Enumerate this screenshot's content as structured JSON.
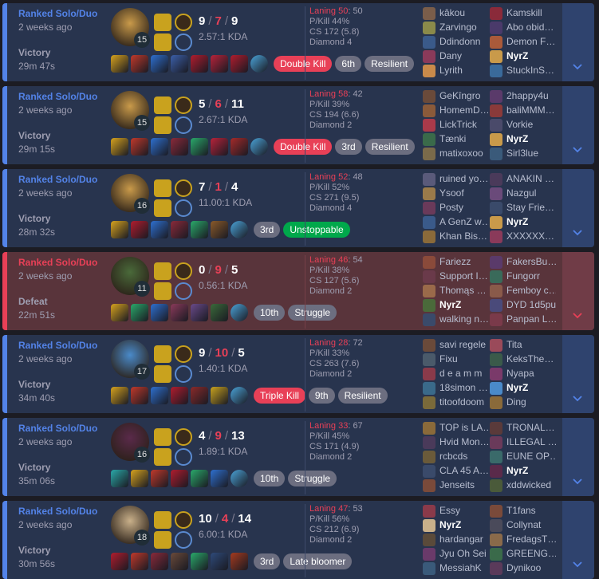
{
  "colors": {
    "win_accent": "#5383e8",
    "loss_accent": "#e84057",
    "win_bg": "#28344e",
    "loss_bg": "#59343b",
    "multikill": "#e84057",
    "unstoppable": "#00a84b"
  },
  "matches": [
    {
      "result_type": "win",
      "queue": "Ranked Solo/Duo",
      "ago": "2 weeks ago",
      "result": "Victory",
      "duration": "29m 47s",
      "level": "15",
      "kills": "9",
      "deaths": "7",
      "assists": "9",
      "kda": "2.57:1 KDA",
      "laning_label": "Laning 50",
      "laning_opp": ": 50",
      "pkill": "P/Kill 44%",
      "cs": "CS 172 (5.8)",
      "rank": "Diamond 4",
      "badges": [
        {
          "text": "Double Kill",
          "kind": "mk"
        },
        {
          "text": "6th",
          "kind": ""
        },
        {
          "text": "Resilient",
          "kind": ""
        }
      ],
      "champ_color": "#c99a4a",
      "items": [
        "#d6a21e",
        "#c0392b",
        "#2e6fcf",
        "#3b5fa8",
        "#b01c2e",
        "#b7233a",
        "#b01c2e",
        "#4aa3d8"
      ],
      "team1": [
        "kâkou",
        "Zarvingo",
        "Ddindonn",
        "Dany",
        "Lyrith"
      ],
      "team2": [
        "Kamskill",
        "Abo obid…",
        "Demon F…",
        "NyrZ",
        "StuckInS…"
      ],
      "me_team": 2,
      "me_index": 3,
      "t1c": [
        "#7a5d4a",
        "#8a8a4a",
        "#3a5a8a",
        "#8a3a5a",
        "#c98a4a"
      ],
      "t2c": [
        "#8a2a3a",
        "#4a3a6a",
        "#aa5a3a",
        "#c99a4a",
        "#3a6a9a"
      ]
    },
    {
      "result_type": "win",
      "queue": "Ranked Solo/Duo",
      "ago": "2 weeks ago",
      "result": "Victory",
      "duration": "29m 15s",
      "level": "15",
      "kills": "5",
      "deaths": "6",
      "assists": "11",
      "kda": "2.67:1 KDA",
      "laning_label": "Laning 58",
      "laning_opp": ": 42",
      "pkill": "P/Kill 39%",
      "cs": "CS 194 (6.6)",
      "rank": "Diamond 2",
      "badges": [
        {
          "text": "Double Kill",
          "kind": "mk"
        },
        {
          "text": "3rd",
          "kind": ""
        },
        {
          "text": "Resilient",
          "kind": ""
        }
      ],
      "champ_color": "#c99a4a",
      "items": [
        "#d6a21e",
        "#c0392b",
        "#2e6fcf",
        "#8a2a3a",
        "#2aa86a",
        "#b7233a",
        "#a52a2a",
        "#4aa3d8"
      ],
      "team1": [
        "GeKîngro",
        "HomemD…",
        "LickTrick",
        "Tænki",
        "matixoxoo"
      ],
      "team2": [
        "2happy4u",
        "baliMMM…",
        "Vorkie",
        "NyrZ",
        "Sirl3lue"
      ],
      "me_team": 2,
      "me_index": 3,
      "t1c": [
        "#6a4a3a",
        "#8a5a3a",
        "#aa3a4a",
        "#3a6a4a",
        "#7a6a4a"
      ],
      "t2c": [
        "#5a3a6a",
        "#8a3a3a",
        "#4a4a6a",
        "#c99a4a",
        "#3a5a7a"
      ]
    },
    {
      "result_type": "win",
      "queue": "Ranked Solo/Duo",
      "ago": "2 weeks ago",
      "result": "Victory",
      "duration": "28m 32s",
      "level": "16",
      "kills": "7",
      "deaths": "1",
      "assists": "4",
      "kda": "11.00:1 KDA",
      "laning_label": "Laning 52",
      "laning_opp": ": 48",
      "pkill": "P/Kill 52%",
      "cs": "CS 271 (9.5)",
      "rank": "Diamond 4",
      "badges": [
        {
          "text": "3rd",
          "kind": ""
        },
        {
          "text": "Unstoppable",
          "kind": "un"
        }
      ],
      "champ_color": "#c99a4a",
      "items": [
        "#d6a21e",
        "#b01c2e",
        "#2e6fcf",
        "#8a2a3a",
        "#2aa86a",
        "#8a5a2a",
        "#4aa3d8"
      ],
      "team1": [
        "ruined yo…",
        "Ysoof",
        "Posty",
        "A GenZ w…",
        "Khan Bis…"
      ],
      "team2": [
        "ANAKIN …",
        "Nazgul",
        "Stay Frie…",
        "NyrZ",
        "XXXXXX…"
      ],
      "me_team": 2,
      "me_index": 3,
      "t1c": [
        "#5a5a7a",
        "#9a7a4a",
        "#6a3a5a",
        "#3a5a8a",
        "#8a6a3a"
      ],
      "t2c": [
        "#4a3a5a",
        "#6a4a7a",
        "#3a4a6a",
        "#c99a4a",
        "#8a3a5a"
      ]
    },
    {
      "result_type": "loss",
      "queue": "Ranked Solo/Duo",
      "ago": "2 weeks ago",
      "result": "Defeat",
      "duration": "22m 51s",
      "level": "11",
      "kills": "0",
      "deaths": "9",
      "assists": "5",
      "kda": "0.56:1 KDA",
      "laning_label": "Laning 46",
      "laning_opp": ": 54",
      "pkill": "P/Kill 38%",
      "cs": "CS 127 (5.6)",
      "rank": "Diamond 2",
      "badges": [
        {
          "text": "10th",
          "kind": ""
        },
        {
          "text": "Struggle",
          "kind": ""
        }
      ],
      "champ_color": "#4a6a3a",
      "items": [
        "#d6a21e",
        "#2aa86a",
        "#2e6fcf",
        "#8a3a5a",
        "#6a4a8a",
        "#3a6a3a",
        "#4aa3d8"
      ],
      "team1": [
        "Fariezz",
        "Support I…",
        "Thomąs …",
        "NyrZ",
        "walking n…"
      ],
      "team2": [
        "FakersBu…",
        "Fungorr",
        "Femboy c…",
        "DYD 1d5pu",
        "Panpan L…"
      ],
      "me_team": 1,
      "me_index": 3,
      "t1c": [
        "#8a4a3a",
        "#6a3a4a",
        "#9a6a4a",
        "#4a6a3a",
        "#3a4a6a"
      ],
      "t2c": [
        "#5a3a6a",
        "#3a6a5a",
        "#8a5a4a",
        "#4a4a7a",
        "#7a3a4a"
      ]
    },
    {
      "result_type": "win",
      "queue": "Ranked Solo/Duo",
      "ago": "2 weeks ago",
      "result": "Victory",
      "duration": "34m 40s",
      "level": "17",
      "kills": "9",
      "deaths": "10",
      "assists": "5",
      "kda": "1.40:1 KDA",
      "laning_label": "Laning 28",
      "laning_opp": ": 72",
      "pkill": "P/Kill 33%",
      "cs": "CS 263 (7.6)",
      "rank": "Diamond 2",
      "badges": [
        {
          "text": "Triple Kill",
          "kind": "mk"
        },
        {
          "text": "9th",
          "kind": ""
        },
        {
          "text": "Resilient",
          "kind": ""
        }
      ],
      "champ_color": "#4a8ac9",
      "items": [
        "#d6a21e",
        "#c0392b",
        "#2e6fcf",
        "#b01c2e",
        "#8a2a2a",
        "#c9a21e",
        "#4aa3d8"
      ],
      "team1": [
        "savi regele",
        "Fixu",
        "d e a m m",
        "18simon …",
        "titoofdoom"
      ],
      "team2": [
        "Tita",
        "KeksThe…",
        "Nyapa",
        "NyrZ",
        "Ding"
      ],
      "me_team": 2,
      "me_index": 3,
      "t1c": [
        "#6a4a3a",
        "#4a5a6a",
        "#8a3a4a",
        "#3a6a8a",
        "#7a6a3a"
      ],
      "t2c": [
        "#9a4a5a",
        "#3a5a4a",
        "#7a3a6a",
        "#4a8ac9",
        "#8a6a3a"
      ]
    },
    {
      "result_type": "win",
      "queue": "Ranked Solo/Duo",
      "ago": "2 weeks ago",
      "result": "Victory",
      "duration": "35m 06s",
      "level": "16",
      "kills": "4",
      "deaths": "9",
      "assists": "13",
      "kda": "1.89:1 KDA",
      "laning_label": "Laning 33",
      "laning_opp": ": 67",
      "pkill": "P/Kill 45%",
      "cs": "CS 171 (4.9)",
      "rank": "Diamond 2",
      "badges": [
        {
          "text": "10th",
          "kind": ""
        },
        {
          "text": "Struggle",
          "kind": ""
        }
      ],
      "champ_color": "#5a2a4a",
      "items": [
        "#2aa8a8",
        "#d6a21e",
        "#c0392b",
        "#b01c2e",
        "#2aa86a",
        "#2e6fcf",
        "#4aa3d8"
      ],
      "team1": [
        "TOP is LA…",
        "Hvid Mon…",
        "rcbcds",
        "CLA 45 A…",
        "Jenseits"
      ],
      "team2": [
        "TRONAL…",
        "ILLEGAL …",
        "EUNE OP…",
        "NyrZ",
        "xddwicked"
      ],
      "me_team": 2,
      "me_index": 3,
      "t1c": [
        "#8a6a3a",
        "#4a3a5a",
        "#6a5a3a",
        "#3a4a6a",
        "#7a4a3a"
      ],
      "t2c": [
        "#5a3a3a",
        "#6a3a5a",
        "#3a6a6a",
        "#5a2a4a",
        "#4a5a3a"
      ]
    },
    {
      "result_type": "win",
      "queue": "Ranked Solo/Duo",
      "ago": "2 weeks ago",
      "result": "Victory",
      "duration": "30m 56s",
      "level": "18",
      "kills": "10",
      "deaths": "4",
      "assists": "14",
      "kda": "6.00:1 KDA",
      "laning_label": "Laning 47",
      "laning_opp": ": 53",
      "pkill": "P/Kill 56%",
      "cs": "CS 212 (6.9)",
      "rank": "Diamond 2",
      "badges": [
        {
          "text": "3rd",
          "kind": ""
        },
        {
          "text": "Late bloomer",
          "kind": ""
        }
      ],
      "champ_color": "#c9b08a",
      "items": [
        "#b01c2e",
        "#c0392b",
        "#8a2a3a",
        "#6a4a3a",
        "#2aa86a",
        "#2e4a7a",
        "#a53a1e"
      ],
      "team1": [
        "Essy",
        "NyrZ",
        "hardangar",
        "Jyu Oh Sei",
        "MessiahK"
      ],
      "team2": [
        "T1fans",
        "Collynat",
        "FredagsT…",
        "GREENG…",
        "Dynikoo"
      ],
      "me_team": 1,
      "me_index": 1,
      "t1c": [
        "#8a3a4a",
        "#c9b08a",
        "#5a4a3a",
        "#6a3a6a",
        "#3a5a7a"
      ],
      "t2c": [
        "#7a4a3a",
        "#4a4a5a",
        "#8a6a4a",
        "#3a6a4a",
        "#5a3a5a"
      ]
    }
  ]
}
